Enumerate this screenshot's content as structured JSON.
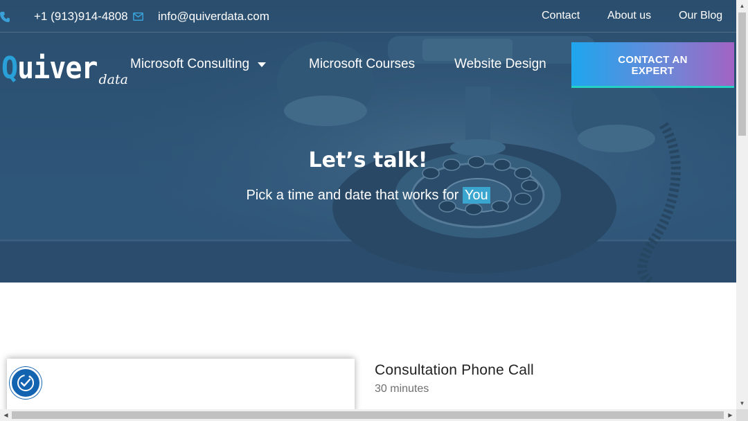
{
  "topbar": {
    "phone": "+1 (913)914-4808",
    "email": "info@quiverdata.com",
    "links": [
      "Contact",
      "About us",
      "Our Blog"
    ]
  },
  "nav": {
    "logo_main_first": "Q",
    "logo_main_rest": "uiver",
    "logo_sub": "data",
    "items": [
      "Microsoft Consulting",
      "Microsoft Courses",
      "Website Design"
    ],
    "cta_line1": "CONTACT AN",
    "cta_line2": "EXPERT"
  },
  "hero": {
    "title": "Let’s talk!",
    "subtitle": "Pick a time and date that works for",
    "highlight": "You"
  },
  "event": {
    "title": "Consultation Phone Call",
    "duration": "30 minutes"
  },
  "colors": {
    "hero_blue": "#2d5475",
    "accent_blue": "#39a0d8",
    "cta_start": "#1ea6ee",
    "cta_end": "#a263c4",
    "cta_underline": "#25d0c4",
    "badge_blue": "#1263b0"
  },
  "icons": [
    "phone-icon",
    "envelope-icon",
    "chevron-down-icon",
    "accessibility-badge-icon"
  ]
}
